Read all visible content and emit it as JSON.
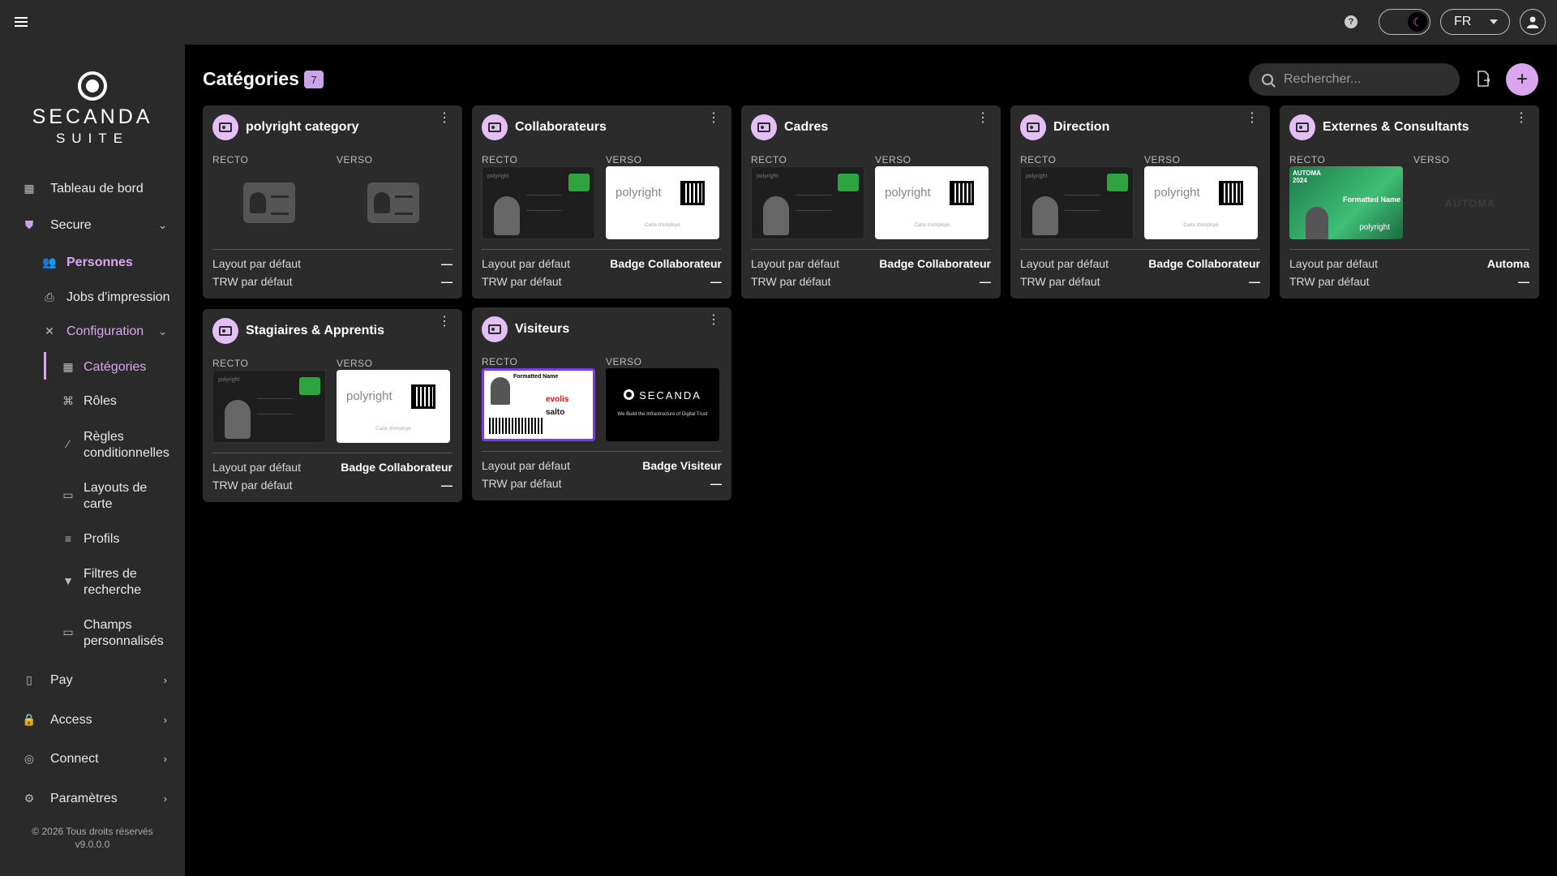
{
  "topbar": {
    "lang": "FR"
  },
  "brand": {
    "name": "SECANDA",
    "sub": "SUITE"
  },
  "sidebar": {
    "items": {
      "dashboard": "Tableau de bord",
      "secure": "Secure",
      "personnes": "Personnes",
      "jobs": "Jobs d'impression",
      "configuration": "Configuration",
      "categories": "Catégories",
      "roles": "Rôles",
      "regles_1": "Règles",
      "regles_2": "conditionnelles",
      "layouts_1": "Layouts de",
      "layouts_2": "carte",
      "profils": "Profils",
      "filtres_1": "Filtres de",
      "filtres_2": "recherche",
      "champs_1": "Champs",
      "champs_2": "personnalisés",
      "pay": "Pay",
      "access": "Access",
      "connect": "Connect",
      "parametres": "Paramètres"
    },
    "footer_line1": "© 2026 Tous droits réservés",
    "footer_line2": "v9.0.0.0"
  },
  "main": {
    "title": "Catégories",
    "count": "7",
    "search_placeholder": "Rechercher...",
    "labels": {
      "recto": "RECTO",
      "verso": "VERSO",
      "layout": "Layout par défaut",
      "trw": "TRW par défaut"
    }
  },
  "cards": [
    {
      "title": "polyright category",
      "layout": "—",
      "trw": "—"
    },
    {
      "title": "Collaborateurs",
      "layout": "Badge Collaborateur",
      "trw": "—"
    },
    {
      "title": "Cadres",
      "layout": "Badge Collaborateur",
      "trw": "—"
    },
    {
      "title": "Direction",
      "layout": "Badge Collaborateur",
      "trw": "—"
    },
    {
      "title": "Externes & Consultants",
      "layout": "Automa",
      "trw": "—"
    },
    {
      "title": "Stagiaires & Apprentis",
      "layout": "Badge Collaborateur",
      "trw": "—"
    },
    {
      "title": "Visiteurs",
      "layout": "Badge Visiteur",
      "trw": "—"
    }
  ],
  "card_art": {
    "polyright": "polyright",
    "carte": "Carte d'employé",
    "automa_front": "AUTOMA",
    "automa_year": "2024",
    "formatted_name": "Formatted Name",
    "automa_back": "AUTOMA",
    "visitor_name": "Formatted Name",
    "evolis": "evolis",
    "salto": "salto",
    "secanda": "SECANDA",
    "secanda_tag": "We Build the Infrastructure of Digital Trust"
  },
  "colors": {
    "accent": "#d9a6ef",
    "sidebar_bg": "#2a2a2a",
    "card_bg": "#2b2b2b"
  }
}
